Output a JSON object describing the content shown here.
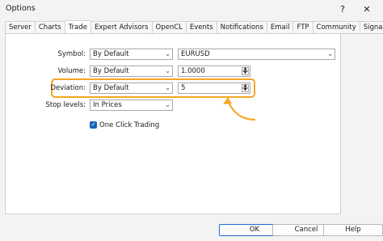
{
  "window": {
    "title": "Options",
    "help_glyph": "?",
    "close_glyph": "✕"
  },
  "tabs": [
    {
      "label": "Server"
    },
    {
      "label": "Charts"
    },
    {
      "label": "Trade"
    },
    {
      "label": "Expert Advisors"
    },
    {
      "label": "OpenCL"
    },
    {
      "label": "Events"
    },
    {
      "label": "Notifications"
    },
    {
      "label": "Email"
    },
    {
      "label": "FTP"
    },
    {
      "label": "Community"
    },
    {
      "label": "Signals"
    }
  ],
  "active_tab": "Trade",
  "form": {
    "symbol": {
      "label": "Symbol:",
      "mode": "By Default",
      "value": "EURUSD"
    },
    "volume": {
      "label": "Volume:",
      "mode": "By Default",
      "value": "1.0000"
    },
    "deviation": {
      "label": "Deviation:",
      "mode": "By Default",
      "value": "5"
    },
    "stop_levels": {
      "label": "Stop levels:",
      "mode": "In Prices"
    },
    "one_click": {
      "label": "One Click Trading",
      "checked": true
    }
  },
  "highlight_color": "#f5a623",
  "footer": {
    "ok_label": "OK",
    "cancel_label": "Cancel",
    "help_label": "Help"
  }
}
